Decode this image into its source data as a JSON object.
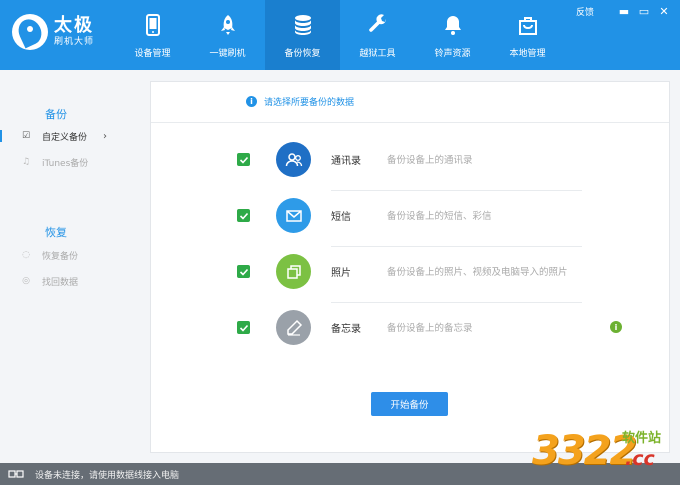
{
  "app": {
    "title": "太极",
    "subtitle": "刷机大师"
  },
  "window_controls": {
    "feedback": "反馈",
    "minimize": "▬",
    "maximize": "▭",
    "close": "✕"
  },
  "nav": [
    {
      "label": "设备管理",
      "icon": "phone-icon"
    },
    {
      "label": "一键刷机",
      "icon": "rocket-icon"
    },
    {
      "label": "备份恢复",
      "icon": "database-icon",
      "active": true
    },
    {
      "label": "越狱工具",
      "icon": "wrench-icon"
    },
    {
      "label": "铃声资源",
      "icon": "bell-icon"
    },
    {
      "label": "本地管理",
      "icon": "bag-icon"
    }
  ],
  "sidebar": {
    "backup_heading": "备份",
    "backup_items": [
      {
        "label": "自定义备份",
        "icon": "checklist-icon",
        "active": true
      },
      {
        "label": "iTunes备份",
        "icon": "music-note-icon"
      }
    ],
    "restore_heading": "恢复",
    "restore_items": [
      {
        "label": "恢复备份",
        "icon": "restore-icon"
      },
      {
        "label": "找回数据",
        "icon": "find-data-icon"
      }
    ]
  },
  "main": {
    "hint": "请选择所要备份的数据",
    "rows": [
      {
        "name": "通讯录",
        "desc": "备份设备上的通讯录",
        "color": "#1f6fc5",
        "icon": "contacts-icon",
        "checked": true
      },
      {
        "name": "短信",
        "desc": "备份设备上的短信、彩信",
        "color": "#2e9be8",
        "icon": "envelope-icon",
        "checked": true
      },
      {
        "name": "照片",
        "desc": "备份设备上的照片、视频及电脑导入的照片",
        "color": "#7cc143",
        "icon": "photos-icon",
        "checked": true
      },
      {
        "name": "备忘录",
        "desc": "备份设备上的备忘录",
        "color": "#9aa1a9",
        "icon": "pencil-icon",
        "checked": true
      }
    ],
    "start_button": "开始备份"
  },
  "status": {
    "text": "设备未连接，请使用数据线接入电脑"
  },
  "watermark": {
    "top": "软件站",
    "number": "3322",
    "domain": ".cc"
  },
  "colors": {
    "primary": "#2192e6",
    "active_tab": "#1a7fcf",
    "check_green": "#2eaa48",
    "statusbar": "#666d75"
  }
}
